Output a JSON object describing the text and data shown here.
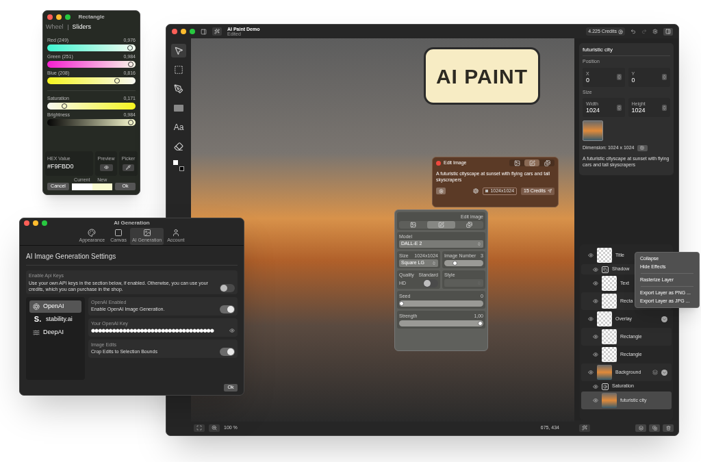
{
  "color_window": {
    "title": "Rectangle",
    "tabs": [
      {
        "label": "Wheel",
        "selected": false
      },
      {
        "label": "Sliders",
        "selected": true
      }
    ],
    "sliders": [
      {
        "kind": "red",
        "label": "Red (249)",
        "reading": "0,976",
        "level": 0.976
      },
      {
        "kind": "green",
        "label": "Green (251)",
        "reading": "0,984",
        "level": 0.984
      },
      {
        "kind": "blue",
        "label": "Blue (208)",
        "reading": "0,816",
        "level": 0.816
      },
      {
        "kind": "saturation",
        "label": "Saturation",
        "reading": "0,171",
        "level": 0.171
      },
      {
        "kind": "brightness",
        "label": "Brightness",
        "reading": "0,984",
        "level": 0.984
      }
    ],
    "hex_label": "HEX Value",
    "hex_value": "#F9FBD0",
    "preview_label": "Preview",
    "picker_label": "Picker",
    "swatches": [
      {
        "label": "Current",
        "color": "#ffffff"
      },
      {
        "label": "New",
        "color": "#f9fbd0"
      }
    ],
    "cancel": "Cancel",
    "ok": "Ok"
  },
  "ai_window": {
    "title": "AI Generation",
    "tabs": [
      {
        "kind": "palette",
        "label": "Appearance",
        "selected": false
      },
      {
        "kind": "canvas",
        "label": "Canvas",
        "selected": false
      },
      {
        "kind": "image",
        "label": "AI Generation",
        "selected": true
      },
      {
        "kind": "user",
        "label": "Account",
        "selected": false
      }
    ],
    "heading": "AI Image Generation Settings",
    "api_keys": {
      "label": "Enable Api Keys",
      "text": "Use your own API keys in the section below, if enabled. Otherwise, you can use your credits, which you can purchase in the shop.",
      "on": false
    },
    "providers": [
      {
        "kind": "openai",
        "name": "OpenAI",
        "selected": true
      },
      {
        "kind": "text-logo",
        "logo": "S.",
        "name": "stability.ai",
        "selected": false
      },
      {
        "kind": "deepai",
        "name": "DeepAI",
        "selected": false
      }
    ],
    "settings": [
      {
        "kind": "toggle",
        "label": "OpenAI Enabled",
        "text": "Enable OpenAI Image Generation.",
        "on": true
      },
      {
        "kind": "secret",
        "label": "Your OpenAI Key",
        "value": "●●●●●●●●●●●●●●●●●●●●●●●●●●●●●●●●●●●"
      },
      {
        "kind": "toggle",
        "label": "Image Edits",
        "text": "Crop Edits to Selection Bounds",
        "on": true
      }
    ],
    "ok": "Ok"
  },
  "main": {
    "title": "AI Paint Demo",
    "subtitle": "Edited",
    "credits": "4.225 Credits",
    "tools": [
      {
        "kind": "select",
        "selected": true
      },
      {
        "kind": "marquee",
        "selected": false
      },
      {
        "kind": "pen",
        "selected": false
      },
      {
        "kind": "shape",
        "selected": false
      },
      {
        "kind": "text",
        "label": "Aa",
        "selected": false
      },
      {
        "kind": "eraser",
        "selected": false
      },
      {
        "kind": "colors",
        "selected": false
      }
    ],
    "canvas_title": "AI PAINT",
    "edit_image": {
      "title": "Edit Image",
      "modes": [
        {
          "kind": "image",
          "selected": false
        },
        {
          "kind": "edit",
          "selected": true
        },
        {
          "kind": "images",
          "selected": false
        }
      ],
      "prompt": "A futuristic cityscape at sunset with flying cars and tall skyscrapers",
      "size": "1024x1024",
      "submit": "15 Credits"
    },
    "settings_panel": {
      "mode_label": "Edit image",
      "modes": [
        {
          "kind": "image",
          "selected": false
        },
        {
          "kind": "edit",
          "selected": true
        },
        {
          "kind": "images",
          "selected": false
        }
      ],
      "model_label": "Model",
      "model": "DALL-E 2",
      "size_label": "Size",
      "size_value": "1024x1024",
      "size": "Square LG",
      "number": {
        "label": "Image Number",
        "value": "3",
        "level": 0.25
      },
      "quality": {
        "label": "Quality",
        "value": "HD",
        "toggle_label": "Standard",
        "on": false
      },
      "style": {
        "label": "Style",
        "disabled": true
      },
      "seed": {
        "label": "Seed",
        "value": "0",
        "level": 0
      },
      "strength": {
        "label": "Strength",
        "value": "1,00",
        "level": 1
      }
    },
    "inspector": {
      "name": "futuristic city",
      "position_label": "Position",
      "position": [
        {
          "label": "X",
          "value": "0"
        },
        {
          "label": "Y",
          "value": "0"
        }
      ],
      "size_label": "Size",
      "size": [
        {
          "label": "Width",
          "value": "1024"
        },
        {
          "label": "Height",
          "value": "1024"
        }
      ],
      "dimension": "Dimension: 1024 x 1024",
      "description": "A futuristic cityscape at sunset with flying cars and tall skyscrapers"
    },
    "layers": [
      {
        "kind": "transparent",
        "name": "Title",
        "selected": false,
        "children": [
          {
            "kind": "shadow",
            "name": "Shadow",
            "selected": false
          },
          {
            "kind": "transparent",
            "name": "Text",
            "selected": false
          },
          {
            "kind": "transparent",
            "name": "Recta",
            "selected": false
          }
        ]
      },
      {
        "kind": "transparent",
        "name": "Overlay",
        "selected": false,
        "expanded": true,
        "children": [
          {
            "kind": "transparent",
            "name": "Rectangle",
            "selected": false
          },
          {
            "kind": "transparent",
            "name": "Rectangle",
            "selected": false
          }
        ]
      },
      {
        "kind": "photo",
        "name": "Background",
        "selected": false,
        "expanded": true,
        "linked": true,
        "children": [
          {
            "kind": "adjustment",
            "name": "Saturation",
            "selected": false
          },
          {
            "kind": "photo",
            "name": "futuristic city",
            "selected": true
          }
        ]
      }
    ],
    "context_menu": [
      {
        "kind": "item",
        "label": "Collapse"
      },
      {
        "kind": "item",
        "label": "Hide Effects"
      },
      {
        "kind": "separator"
      },
      {
        "kind": "item",
        "label": "Rasterize Layer"
      },
      {
        "kind": "separator"
      },
      {
        "kind": "item",
        "label": "Export Layer as PNG ..."
      },
      {
        "kind": "item",
        "label": "Export Layer as JPG ..."
      }
    ],
    "zoom": "100 %",
    "cursor": "675, 434"
  }
}
